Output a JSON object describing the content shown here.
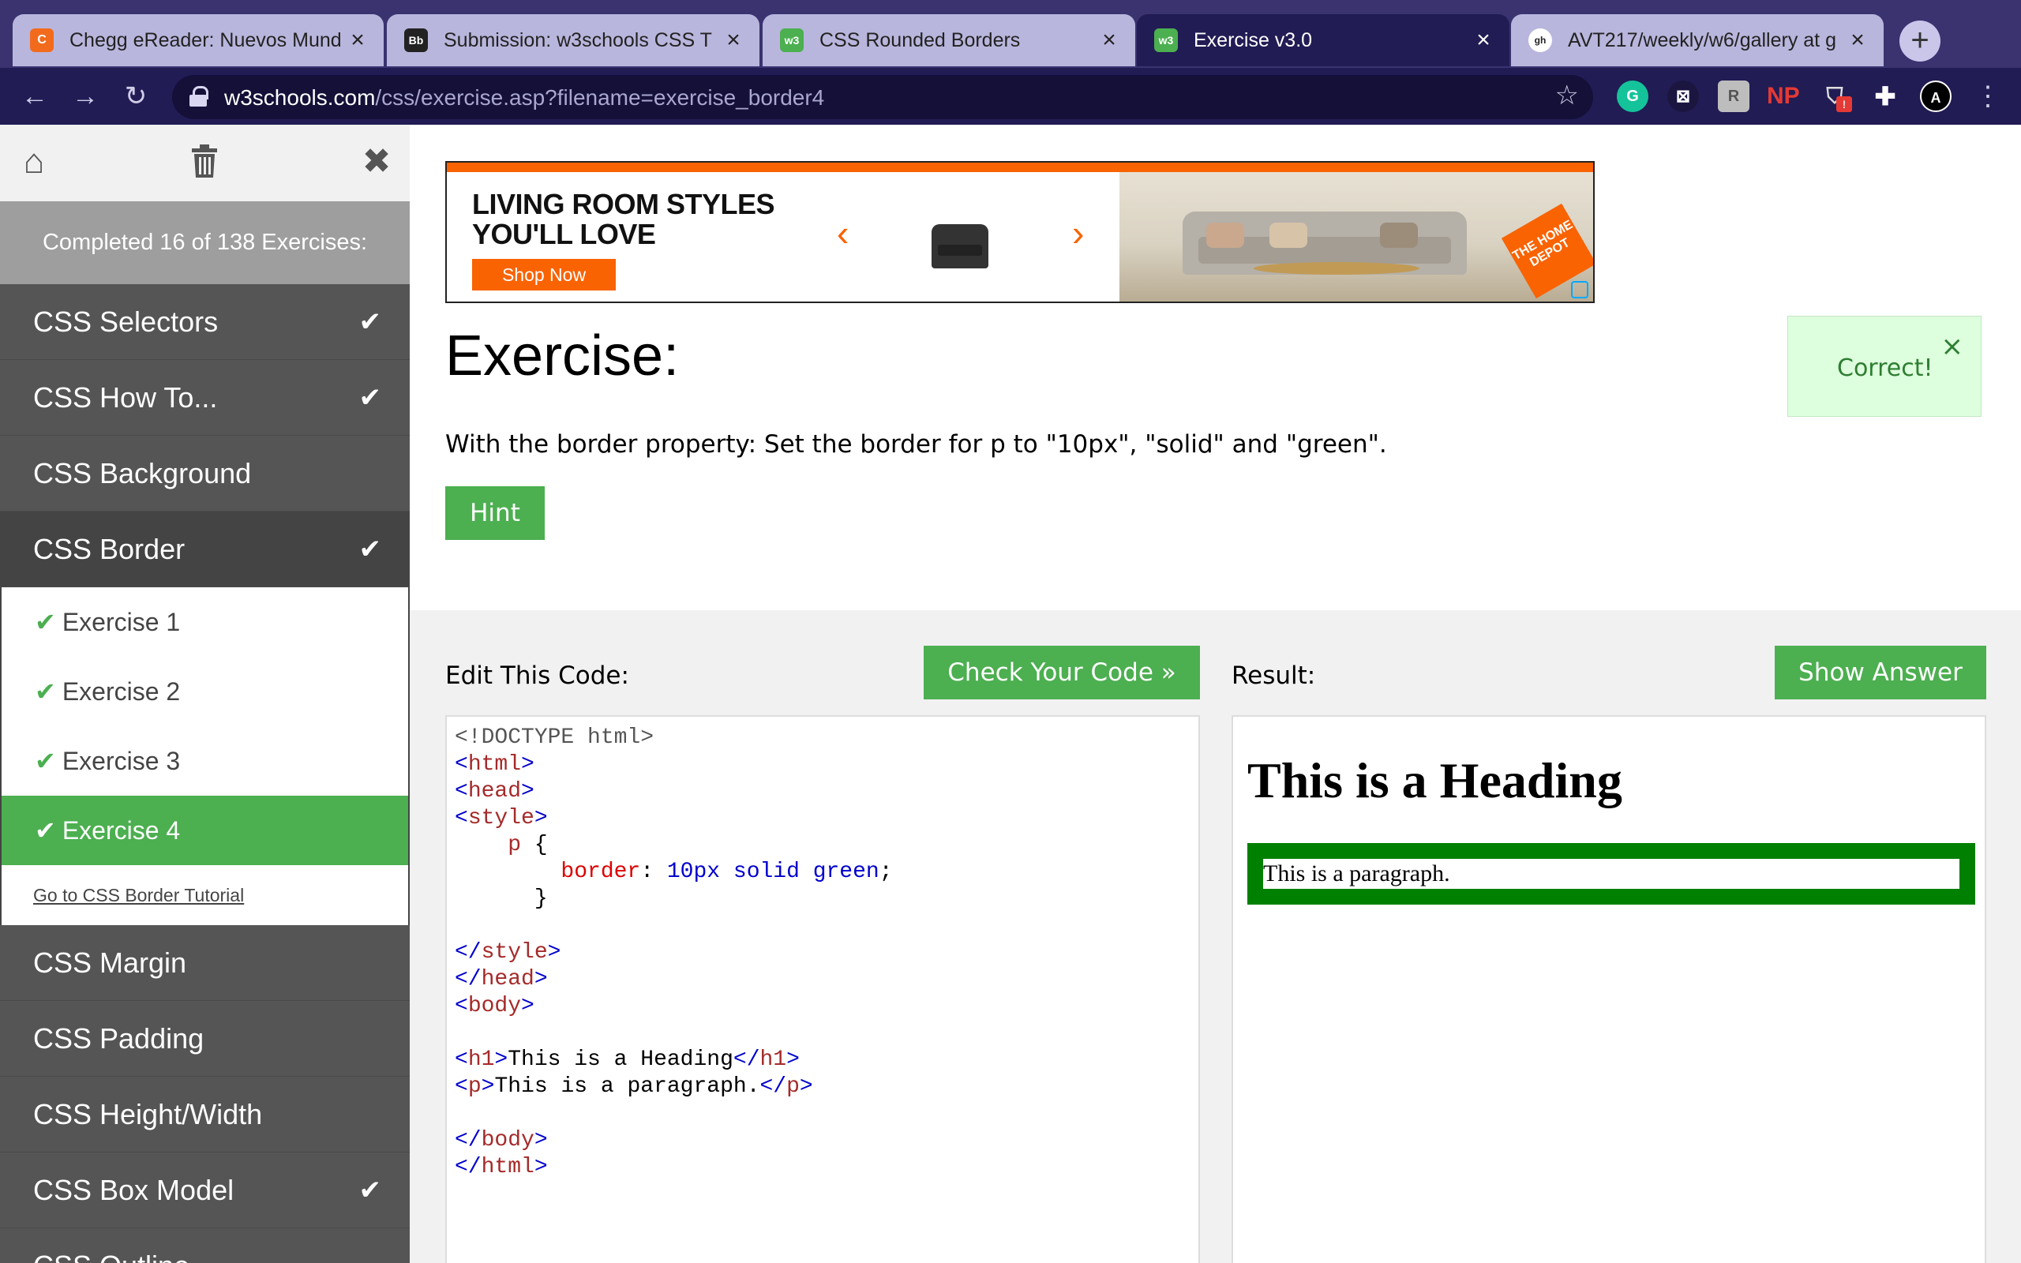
{
  "browser": {
    "tabs": [
      {
        "title": "Chegg eReader: Nuevos Mund",
        "favicon": "C"
      },
      {
        "title": "Submission: w3schools CSS T",
        "favicon": "Bb"
      },
      {
        "title": "CSS Rounded Borders",
        "favicon": "w3"
      },
      {
        "title": "Exercise v3.0",
        "favicon": "w3"
      },
      {
        "title": "AVT217/weekly/w6/gallery at g",
        "favicon": "gh"
      }
    ],
    "url_host": "w3schools.com",
    "url_path": "/css/exercise.asp?filename=exercise_border4",
    "ext_np": "NP",
    "ext_badge": "!"
  },
  "sidebar": {
    "progress": "Completed 16 of 138 Exercises:",
    "items_top": [
      {
        "label": "CSS Selectors",
        "done": "✔"
      },
      {
        "label": "CSS How To...",
        "done": "✔"
      },
      {
        "label": "CSS Background",
        "done": ""
      },
      {
        "label": "CSS Border",
        "done": "✔"
      }
    ],
    "exercises": [
      "Exercise 1",
      "Exercise 2",
      "Exercise 3",
      "Exercise 4"
    ],
    "check": "✔",
    "tutorial_link": "Go to CSS Border Tutorial",
    "items_bottom": [
      {
        "label": "CSS Margin",
        "done": ""
      },
      {
        "label": "CSS Padding",
        "done": ""
      },
      {
        "label": "CSS Height/Width",
        "done": ""
      },
      {
        "label": "CSS Box Model",
        "done": "✔"
      },
      {
        "label": "CSS Outline",
        "done": ""
      }
    ]
  },
  "ad": {
    "line1": "LIVING ROOM STYLES",
    "line2": "YOU'LL LOVE",
    "cta": "Shop Now",
    "logo": "THE HOME DEPOT",
    "prev": "‹",
    "next": "›"
  },
  "exercise": {
    "title": "Exercise:",
    "instruction": "With the border property: Set the border for p to \"10px\", \"solid\" and \"green\".",
    "hint": "Hint",
    "correct": "Correct!",
    "correct_close": "×",
    "edit_label": "Edit This Code:",
    "check_button": "Check Your Code »",
    "result_label": "Result:",
    "show_answer": "Show Answer"
  },
  "code": {
    "doctype": "<!DOCTYPE html>",
    "lines": {
      "html_open": "html",
      "head_open": "head",
      "style_open": "style",
      "selector": "p",
      "brace_open": "{",
      "prop": "border",
      "colon": ":",
      "value": "10px solid green",
      "semi": ";",
      "brace_close": "}",
      "style_close": "style",
      "head_close": "head",
      "body_open": "body",
      "h1_tag": "h1",
      "h1_text": "This is a Heading",
      "p_tag": "p",
      "p_text": "This is a paragraph.",
      "body_close": "body",
      "html_close": "html"
    }
  },
  "result": {
    "heading": "This is a Heading",
    "paragraph": "This is a paragraph."
  },
  "colors": {
    "w3_green": "#4caf50",
    "sidebar_dark": "#555555",
    "tab_active": "#211c54",
    "homedepot_orange": "#f96302"
  }
}
